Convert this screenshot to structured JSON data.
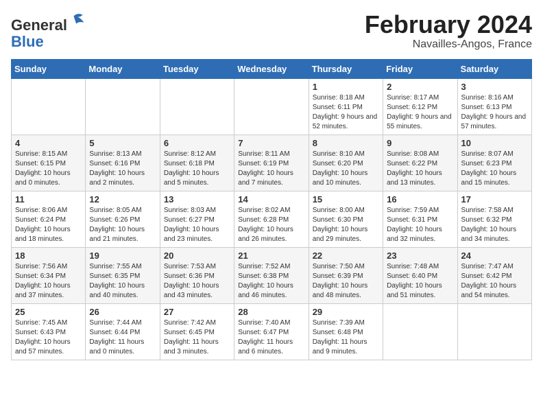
{
  "header": {
    "logo_general": "General",
    "logo_blue": "Blue",
    "title": "February 2024",
    "subtitle": "Navailles-Angos, France"
  },
  "days_of_week": [
    "Sunday",
    "Monday",
    "Tuesday",
    "Wednesday",
    "Thursday",
    "Friday",
    "Saturday"
  ],
  "weeks": [
    [
      {
        "day": "",
        "info": ""
      },
      {
        "day": "",
        "info": ""
      },
      {
        "day": "",
        "info": ""
      },
      {
        "day": "",
        "info": ""
      },
      {
        "day": "1",
        "info": "Sunrise: 8:18 AM\nSunset: 6:11 PM\nDaylight: 9 hours\nand 52 minutes."
      },
      {
        "day": "2",
        "info": "Sunrise: 8:17 AM\nSunset: 6:12 PM\nDaylight: 9 hours\nand 55 minutes."
      },
      {
        "day": "3",
        "info": "Sunrise: 8:16 AM\nSunset: 6:13 PM\nDaylight: 9 hours\nand 57 minutes."
      }
    ],
    [
      {
        "day": "4",
        "info": "Sunrise: 8:15 AM\nSunset: 6:15 PM\nDaylight: 10 hours\nand 0 minutes."
      },
      {
        "day": "5",
        "info": "Sunrise: 8:13 AM\nSunset: 6:16 PM\nDaylight: 10 hours\nand 2 minutes."
      },
      {
        "day": "6",
        "info": "Sunrise: 8:12 AM\nSunset: 6:18 PM\nDaylight: 10 hours\nand 5 minutes."
      },
      {
        "day": "7",
        "info": "Sunrise: 8:11 AM\nSunset: 6:19 PM\nDaylight: 10 hours\nand 7 minutes."
      },
      {
        "day": "8",
        "info": "Sunrise: 8:10 AM\nSunset: 6:20 PM\nDaylight: 10 hours\nand 10 minutes."
      },
      {
        "day": "9",
        "info": "Sunrise: 8:08 AM\nSunset: 6:22 PM\nDaylight: 10 hours\nand 13 minutes."
      },
      {
        "day": "10",
        "info": "Sunrise: 8:07 AM\nSunset: 6:23 PM\nDaylight: 10 hours\nand 15 minutes."
      }
    ],
    [
      {
        "day": "11",
        "info": "Sunrise: 8:06 AM\nSunset: 6:24 PM\nDaylight: 10 hours\nand 18 minutes."
      },
      {
        "day": "12",
        "info": "Sunrise: 8:05 AM\nSunset: 6:26 PM\nDaylight: 10 hours\nand 21 minutes."
      },
      {
        "day": "13",
        "info": "Sunrise: 8:03 AM\nSunset: 6:27 PM\nDaylight: 10 hours\nand 23 minutes."
      },
      {
        "day": "14",
        "info": "Sunrise: 8:02 AM\nSunset: 6:28 PM\nDaylight: 10 hours\nand 26 minutes."
      },
      {
        "day": "15",
        "info": "Sunrise: 8:00 AM\nSunset: 6:30 PM\nDaylight: 10 hours\nand 29 minutes."
      },
      {
        "day": "16",
        "info": "Sunrise: 7:59 AM\nSunset: 6:31 PM\nDaylight: 10 hours\nand 32 minutes."
      },
      {
        "day": "17",
        "info": "Sunrise: 7:58 AM\nSunset: 6:32 PM\nDaylight: 10 hours\nand 34 minutes."
      }
    ],
    [
      {
        "day": "18",
        "info": "Sunrise: 7:56 AM\nSunset: 6:34 PM\nDaylight: 10 hours\nand 37 minutes."
      },
      {
        "day": "19",
        "info": "Sunrise: 7:55 AM\nSunset: 6:35 PM\nDaylight: 10 hours\nand 40 minutes."
      },
      {
        "day": "20",
        "info": "Sunrise: 7:53 AM\nSunset: 6:36 PM\nDaylight: 10 hours\nand 43 minutes."
      },
      {
        "day": "21",
        "info": "Sunrise: 7:52 AM\nSunset: 6:38 PM\nDaylight: 10 hours\nand 46 minutes."
      },
      {
        "day": "22",
        "info": "Sunrise: 7:50 AM\nSunset: 6:39 PM\nDaylight: 10 hours\nand 48 minutes."
      },
      {
        "day": "23",
        "info": "Sunrise: 7:48 AM\nSunset: 6:40 PM\nDaylight: 10 hours\nand 51 minutes."
      },
      {
        "day": "24",
        "info": "Sunrise: 7:47 AM\nSunset: 6:42 PM\nDaylight: 10 hours\nand 54 minutes."
      }
    ],
    [
      {
        "day": "25",
        "info": "Sunrise: 7:45 AM\nSunset: 6:43 PM\nDaylight: 10 hours\nand 57 minutes."
      },
      {
        "day": "26",
        "info": "Sunrise: 7:44 AM\nSunset: 6:44 PM\nDaylight: 11 hours\nand 0 minutes."
      },
      {
        "day": "27",
        "info": "Sunrise: 7:42 AM\nSunset: 6:45 PM\nDaylight: 11 hours\nand 3 minutes."
      },
      {
        "day": "28",
        "info": "Sunrise: 7:40 AM\nSunset: 6:47 PM\nDaylight: 11 hours\nand 6 minutes."
      },
      {
        "day": "29",
        "info": "Sunrise: 7:39 AM\nSunset: 6:48 PM\nDaylight: 11 hours\nand 9 minutes."
      },
      {
        "day": "",
        "info": ""
      },
      {
        "day": "",
        "info": ""
      }
    ]
  ]
}
